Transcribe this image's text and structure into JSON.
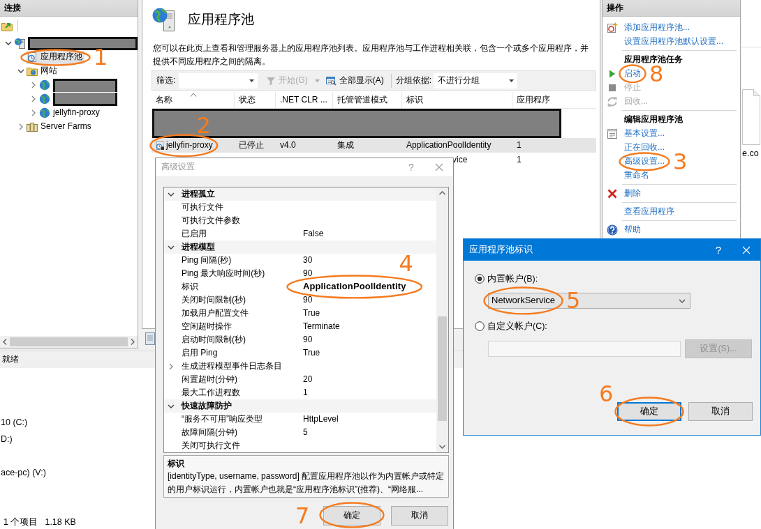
{
  "iis_window": {
    "connections_panel": {
      "title": "连接",
      "tree": [
        {
          "kind": "server",
          "redacted": true,
          "expanded": true,
          "selected": false,
          "children": [
            {
              "kind": "app_pools",
              "label": "应用程序池",
              "redacted": false,
              "selected": true,
              "annotation": "1"
            },
            {
              "kind": "sites",
              "label": "网站",
              "redacted": false,
              "expanded": true,
              "selected": false,
              "children": [
                {
                  "kind": "site",
                  "redacted": true,
                  "expanded": false,
                  "selected": false
                },
                {
                  "kind": "site",
                  "redacted": true,
                  "expanded": false,
                  "selected": false
                },
                {
                  "kind": "site",
                  "label": "jellyfin-proxy",
                  "redacted": false,
                  "expanded": false,
                  "selected": false
                }
              ]
            },
            {
              "kind": "farms",
              "label": "Server Farms",
              "redacted": false,
              "expanded": false,
              "selected": false
            }
          ]
        }
      ]
    },
    "app_pools_page": {
      "title": "应用程序池",
      "description": "您可以在此页上查看和管理服务器上的应用程序池列表。应用程序池与工作进程相关联，包含一个或多个应用程序，并提供不同应用程序之间的隔离。",
      "toolbar": {
        "filter_label": "筛选:",
        "start": {
          "label": "开始(G)",
          "disabled": true
        },
        "show_all": {
          "label": "全部显示(A)",
          "disabled": false
        },
        "group_label": "分组依据:",
        "group_by": "不进行分组"
      },
      "table": {
        "columns": [
          {
            "label": "名称",
            "sorted": true
          },
          {
            "label": "状态",
            "sorted": false
          },
          {
            "label": ".NET CLR ...",
            "sorted": false
          },
          {
            "label": "托管管道模式",
            "sorted": false
          },
          {
            "label": "标识",
            "sorted": false
          },
          {
            "label": "应用程序",
            "sorted": false
          }
        ],
        "rows": [
          {
            "redacted": true,
            "selected": false
          },
          {
            "redacted": true,
            "selected": false
          },
          {
            "redacted": false,
            "selected": true,
            "annotation": "2",
            "cells": {
              "name": "jellyfin-proxy",
              "status": "已停止",
              "clr_version": "v4.0",
              "pipeline_mode": "集成",
              "identity": "ApplicationPoolIdentity",
              "applications": "1"
            }
          },
          {
            "redacted": false,
            "selected": false,
            "cells": {
              "identity": "vice",
              "applications": "1"
            }
          }
        ]
      }
    },
    "actions_panel": {
      "title": "操作",
      "sections": [
        {
          "items": [
            {
              "kind": "add",
              "label": "添加应用程序池...",
              "disabled": false
            },
            {
              "kind": "link",
              "label": "设置应用程序池默认设置...",
              "disabled": false
            }
          ]
        },
        {
          "heading": "应用程序池任务",
          "items": [
            {
              "kind": "start",
              "label": "启动",
              "disabled": false,
              "annotation": "8"
            },
            {
              "kind": "stop",
              "label": "停止",
              "disabled": true
            },
            {
              "kind": "recycle",
              "label": "回收...",
              "disabled": true
            }
          ]
        },
        {
          "heading": "编辑应用程序池",
          "items": [
            {
              "kind": "basic",
              "label": "基本设置...",
              "disabled": false
            },
            {
              "kind": "link",
              "label": "正在回收...",
              "disabled": false
            },
            {
              "kind": "link",
              "label": "高级设置...",
              "disabled": false,
              "annotation": "3"
            },
            {
              "kind": "link",
              "label": "重命名",
              "disabled": false
            }
          ]
        },
        {
          "items": [
            {
              "kind": "delete",
              "label": "删除",
              "disabled": false
            }
          ]
        },
        {
          "items": [
            {
              "kind": "link",
              "label": "查看应用程序",
              "disabled": false
            }
          ]
        },
        {
          "items": [
            {
              "kind": "help",
              "label": "帮助",
              "disabled": false
            }
          ]
        }
      ]
    },
    "status_bar": "就绪"
  },
  "advanced_settings_dialog": {
    "title": "高级设置",
    "active": false,
    "help": "?",
    "categories": [
      {
        "label": "进程孤立",
        "expanded": true,
        "properties": [
          {
            "name": "可执行文件"
          },
          {
            "name": "可执行文件参数"
          },
          {
            "name": "已启用",
            "value": "False",
            "modified": false
          }
        ]
      },
      {
        "label": "进程模型",
        "expanded": true,
        "properties": [
          {
            "name": "Ping 间隔(秒)",
            "value": "30",
            "modified": false
          },
          {
            "name": "Ping 最大响应时间(秒)",
            "value": "90",
            "modified": false
          },
          {
            "name": "标识",
            "value": "ApplicationPoolIdentity",
            "modified": true,
            "annotation": "4"
          },
          {
            "name": "关闭时间限制(秒)",
            "value": "90",
            "modified": false
          },
          {
            "name": "加载用户配置文件",
            "value": "True",
            "modified": false
          },
          {
            "name": "空闲超时操作",
            "value": "Terminate",
            "modified": false
          },
          {
            "name": "启动时间限制(秒)",
            "value": "90",
            "modified": false
          },
          {
            "name": "启用 Ping",
            "value": "True",
            "modified": false
          },
          {
            "name": "生成进程模型事件日志条目",
            "expanded": false
          },
          {
            "name": "闲置超时(分钟)",
            "value": "20",
            "modified": false
          },
          {
            "name": "最大工作进程数",
            "value": "1",
            "modified": false
          }
        ]
      },
      {
        "label": "快速故障防护",
        "expanded": true,
        "properties": [
          {
            "name": "“服务不可用”响应类型",
            "value": "HttpLevel",
            "modified": false
          },
          {
            "name": "故障间隔(分钟)",
            "value": "5",
            "modified": false
          },
          {
            "name": "关闭可执行文件"
          }
        ]
      }
    ],
    "description": {
      "title": "标识",
      "text": "[identityType, username, password] 配置应用程序池以作为内置帐户或特定的用户标识运行，内置帐户也就是“应用程序池标识”(推荐)、“网络服..."
    },
    "buttons": [
      {
        "label": "确定",
        "default": false,
        "annotation": "7"
      },
      {
        "label": "取消",
        "default": false
      }
    ]
  },
  "identity_dialog": {
    "title": "应用程序池标识",
    "active": true,
    "help": "?",
    "options": [
      {
        "label": "内置帐户(B):",
        "selected": true
      },
      {
        "label": "自定义帐户(C):",
        "selected": false
      }
    ],
    "builtin_account": {
      "value": "NetworkService",
      "annotation": "5"
    },
    "custom_account": {
      "disabled": true
    },
    "set_button": {
      "label": "设置(S)...",
      "disabled": true
    },
    "buttons": [
      {
        "label": "确定",
        "default": true,
        "annotation": "6"
      },
      {
        "label": "取消",
        "default": false
      }
    ]
  },
  "background": {
    "explorer_drives": [
      "10 (C:)",
      "D:)",
      "ace-pc) (V:)"
    ],
    "explorer_status": [
      "1 个项目",
      "1.18 KB"
    ],
    "side_window_text": "e.co"
  }
}
